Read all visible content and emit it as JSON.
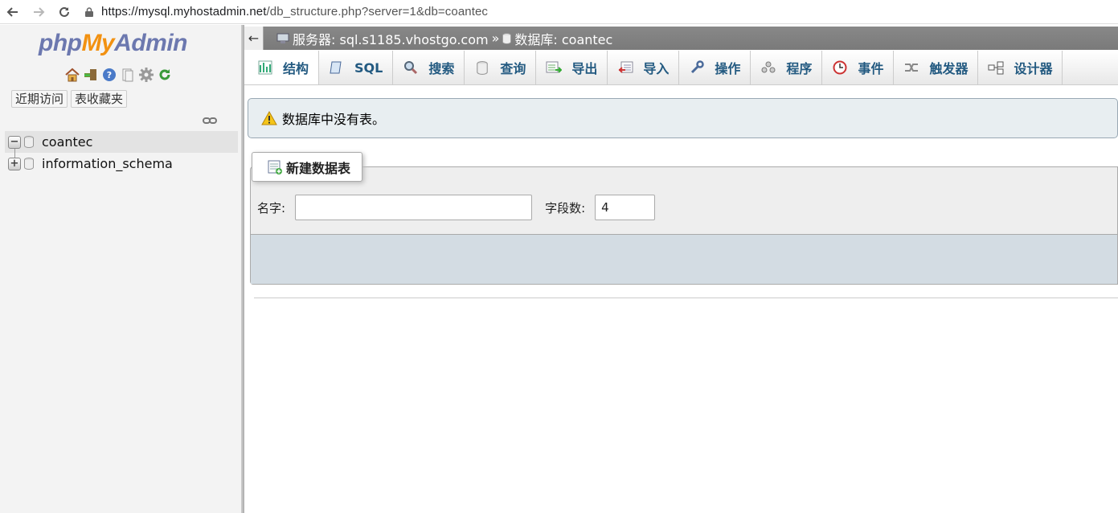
{
  "browser": {
    "url_host": "https://mysql.myhostadmin.net",
    "url_path": "/db_structure.php?server=1&db=coantec"
  },
  "nav": {
    "logo_php": "php",
    "logo_my": "My",
    "logo_admin": "Admin",
    "recent_label": "近期访问",
    "favorites_label": "表收藏夹",
    "databases": [
      {
        "name": "coantec",
        "expander": "−"
      },
      {
        "name": "information_schema",
        "expander": "+"
      }
    ]
  },
  "breadcrumb": {
    "back_arrow": "←",
    "server": "服务器: sql.s1185.vhostgo.com",
    "separator": "»",
    "database": "数据库: coantec"
  },
  "tabs": [
    {
      "label": "结构",
      "icon": "structure-icon"
    },
    {
      "label": "SQL",
      "icon": "sql-icon"
    },
    {
      "label": "搜索",
      "icon": "search-icon"
    },
    {
      "label": "查询",
      "icon": "query-icon"
    },
    {
      "label": "导出",
      "icon": "export-icon"
    },
    {
      "label": "导入",
      "icon": "import-icon"
    },
    {
      "label": "操作",
      "icon": "wrench-icon"
    },
    {
      "label": "程序",
      "icon": "routines-icon"
    },
    {
      "label": "事件",
      "icon": "clock-icon"
    },
    {
      "label": "触发器",
      "icon": "trigger-icon"
    },
    {
      "label": "设计器",
      "icon": "designer-icon"
    }
  ],
  "notice": {
    "text": "数据库中没有表。"
  },
  "create_table": {
    "legend": "新建数据表",
    "name_label": "名字:",
    "name_value": "",
    "columns_label": "字段数:",
    "columns_value": "4"
  },
  "colors": {
    "tab_text": "#235a81",
    "logo_blue": "#6c78af",
    "logo_orange": "#f29111",
    "notice_bg": "#e8eef1"
  }
}
